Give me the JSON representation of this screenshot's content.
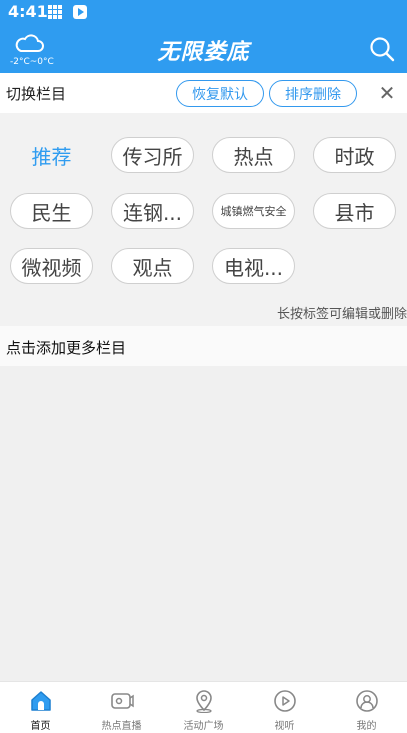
{
  "status_bar": {
    "time": "4:41"
  },
  "header": {
    "weather_temp": "-2°C~0°C",
    "title": "无限娄底"
  },
  "toolbar": {
    "label": "切换栏目",
    "reset_label": "恢复默认",
    "sort_delete_label": "排序删除",
    "close_glyph": "✕"
  },
  "channels": [
    {
      "label": "推荐",
      "active": true
    },
    {
      "label": "传习所"
    },
    {
      "label": "热点"
    },
    {
      "label": "时政"
    },
    {
      "label": "民生"
    },
    {
      "label": "连钢..."
    },
    {
      "label": "城镇燃气安全"
    },
    {
      "label": "县市"
    },
    {
      "label": "微视频"
    },
    {
      "label": "观点"
    },
    {
      "label": "电视..."
    }
  ],
  "hint": "长按标签可编辑或删除",
  "add_more": "点击添加更多栏目",
  "tabbar": [
    {
      "label": "首页",
      "icon": "home-icon",
      "active": true
    },
    {
      "label": "热点直播",
      "icon": "live-tv-icon"
    },
    {
      "label": "活动广场",
      "icon": "location-pin-icon"
    },
    {
      "label": "视听",
      "icon": "play-circle-icon"
    },
    {
      "label": "我的",
      "icon": "profile-icon"
    }
  ],
  "colors": {
    "brand": "#2f9cf0",
    "accent": "#3399ee"
  }
}
